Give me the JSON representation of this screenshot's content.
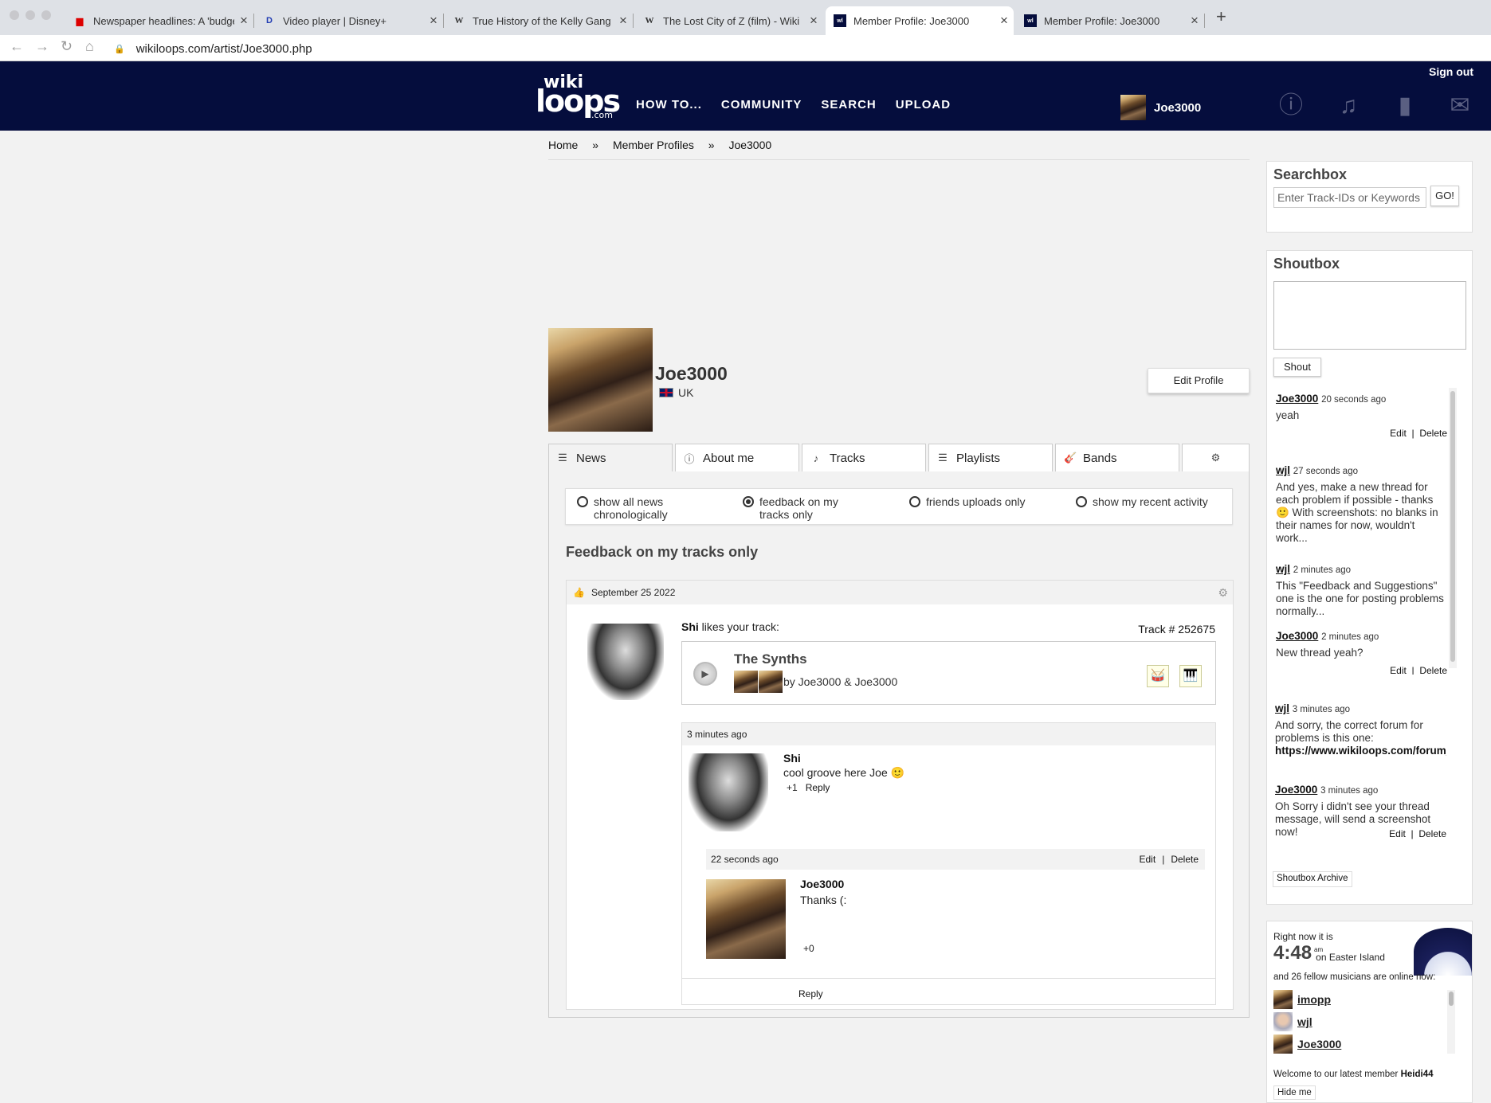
{
  "browser": {
    "tabs": [
      {
        "title": "Newspaper headlines: A 'budge",
        "favicon": "newspaper-icon"
      },
      {
        "title": "Video player | Disney+",
        "favicon": "disney-icon"
      },
      {
        "title": "True History of the Kelly Gang",
        "favicon": "wikipedia-icon"
      },
      {
        "title": "The Lost City of Z (film) - Wiki",
        "favicon": "wikipedia-icon"
      },
      {
        "title": "Member Profile: Joe3000",
        "favicon": "wikiloops-icon",
        "active": true
      },
      {
        "title": "Member Profile: Joe3000",
        "favicon": "wikiloops-icon"
      }
    ],
    "url": "wikiloops.com/artist/Joe3000.php"
  },
  "header": {
    "logo": {
      "wiki": "wiki",
      "loops": "loops",
      "com": ".com"
    },
    "nav": [
      "HOW TO...",
      "COMMUNITY",
      "SEARCH",
      "UPLOAD"
    ],
    "username": "Joe3000",
    "sign_out": "Sign out",
    "icons": [
      "info-icon",
      "music-note-icon",
      "book-icon",
      "mail-icon"
    ],
    "bg_color": "#050d3d"
  },
  "breadcrumb": [
    "Home",
    "»",
    "Member Profiles",
    "»",
    "Joe3000"
  ],
  "profile": {
    "name": "Joe3000",
    "country": "UK",
    "edit_label": "Edit Profile",
    "tabs": [
      {
        "label": "News",
        "icon": "list-icon"
      },
      {
        "label": "About me",
        "icon": "info-icon"
      },
      {
        "label": "Tracks",
        "icon": "music-note-icon"
      },
      {
        "label": "Playlists",
        "icon": "list-icon"
      },
      {
        "label": "Bands",
        "icon": "guitar-icon"
      },
      {
        "label": "",
        "icon": "gear-icon"
      }
    ],
    "filters": [
      {
        "label": "show all news chronologically",
        "checked": false
      },
      {
        "label": "feedback on my tracks only",
        "checked": true
      },
      {
        "label": "friends uploads only",
        "checked": false
      },
      {
        "label": "show my recent activity",
        "checked": false
      }
    ],
    "section_title": "Feedback on my tracks only"
  },
  "feed": {
    "date": "September 25 2022",
    "liker": "Shi",
    "likes_text": "likes your track:",
    "track_link": "Track # 252675",
    "track_title": "The Synths",
    "track_by": "by Joe3000 & Joe3000",
    "instruments": [
      "drums-icon",
      "keyboard-icon"
    ],
    "comment_time": "3 minutes ago",
    "comment_user": "Shi",
    "comment_text": "cool groove here Joe",
    "comment_votes": "+1",
    "reply_label": "Reply",
    "reply_time": "22 seconds ago",
    "edit_label": "Edit",
    "delete_label": "Delete",
    "reply_user": "Joe3000",
    "reply_text": "Thanks (:",
    "reply_votes": "+0",
    "bottom_reply": "Reply"
  },
  "sidebar": {
    "search_title": "Searchbox",
    "search_placeholder": "Enter Track-IDs or Keywords",
    "go_label": "GO!",
    "shoutbox_title": "Shoutbox",
    "shout_label": "Shout",
    "shouts": [
      {
        "user": "Joe3000",
        "ago": "20 seconds ago",
        "text": "yeah",
        "editable": true
      },
      {
        "user": "wjl",
        "ago": "27 seconds ago",
        "text": "And yes, make a new thread for each problem if possible - thanks 🙂 With screenshots: no blanks in their names for now, wouldn't work...",
        "editable": false
      },
      {
        "user": "wjl",
        "ago": "2 minutes ago",
        "text": "This \"Feedback and Suggestions\" one is the one for posting problems normally...",
        "editable": false
      },
      {
        "user": "Joe3000",
        "ago": "2 minutes ago",
        "text": "New thread yeah?",
        "editable": true
      },
      {
        "user": "wjl",
        "ago": "3 minutes ago",
        "text": "And sorry, the correct forum for problems is this one:",
        "link": "https://www.wikiloops.com/forum_id=2",
        "editable": false
      },
      {
        "user": "Joe3000",
        "ago": "3 minutes ago",
        "text": "Oh Sorry i didn't see your thread message, will send a screenshot now!",
        "editable": true
      }
    ],
    "edit_label": "Edit",
    "delete_label": "Delete",
    "archive_label": "Shoutbox Archive",
    "online": {
      "right_now": "Right now it is",
      "time": "4:48",
      "ampm": "am",
      "place": "on Easter Island",
      "fellow": "and 26 fellow musicians are online now:",
      "users": [
        "imopp",
        "wjl",
        "Joe3000"
      ],
      "welcome": "Welcome to our latest member",
      "latest": "Heidi44",
      "hide": "Hide me"
    }
  }
}
